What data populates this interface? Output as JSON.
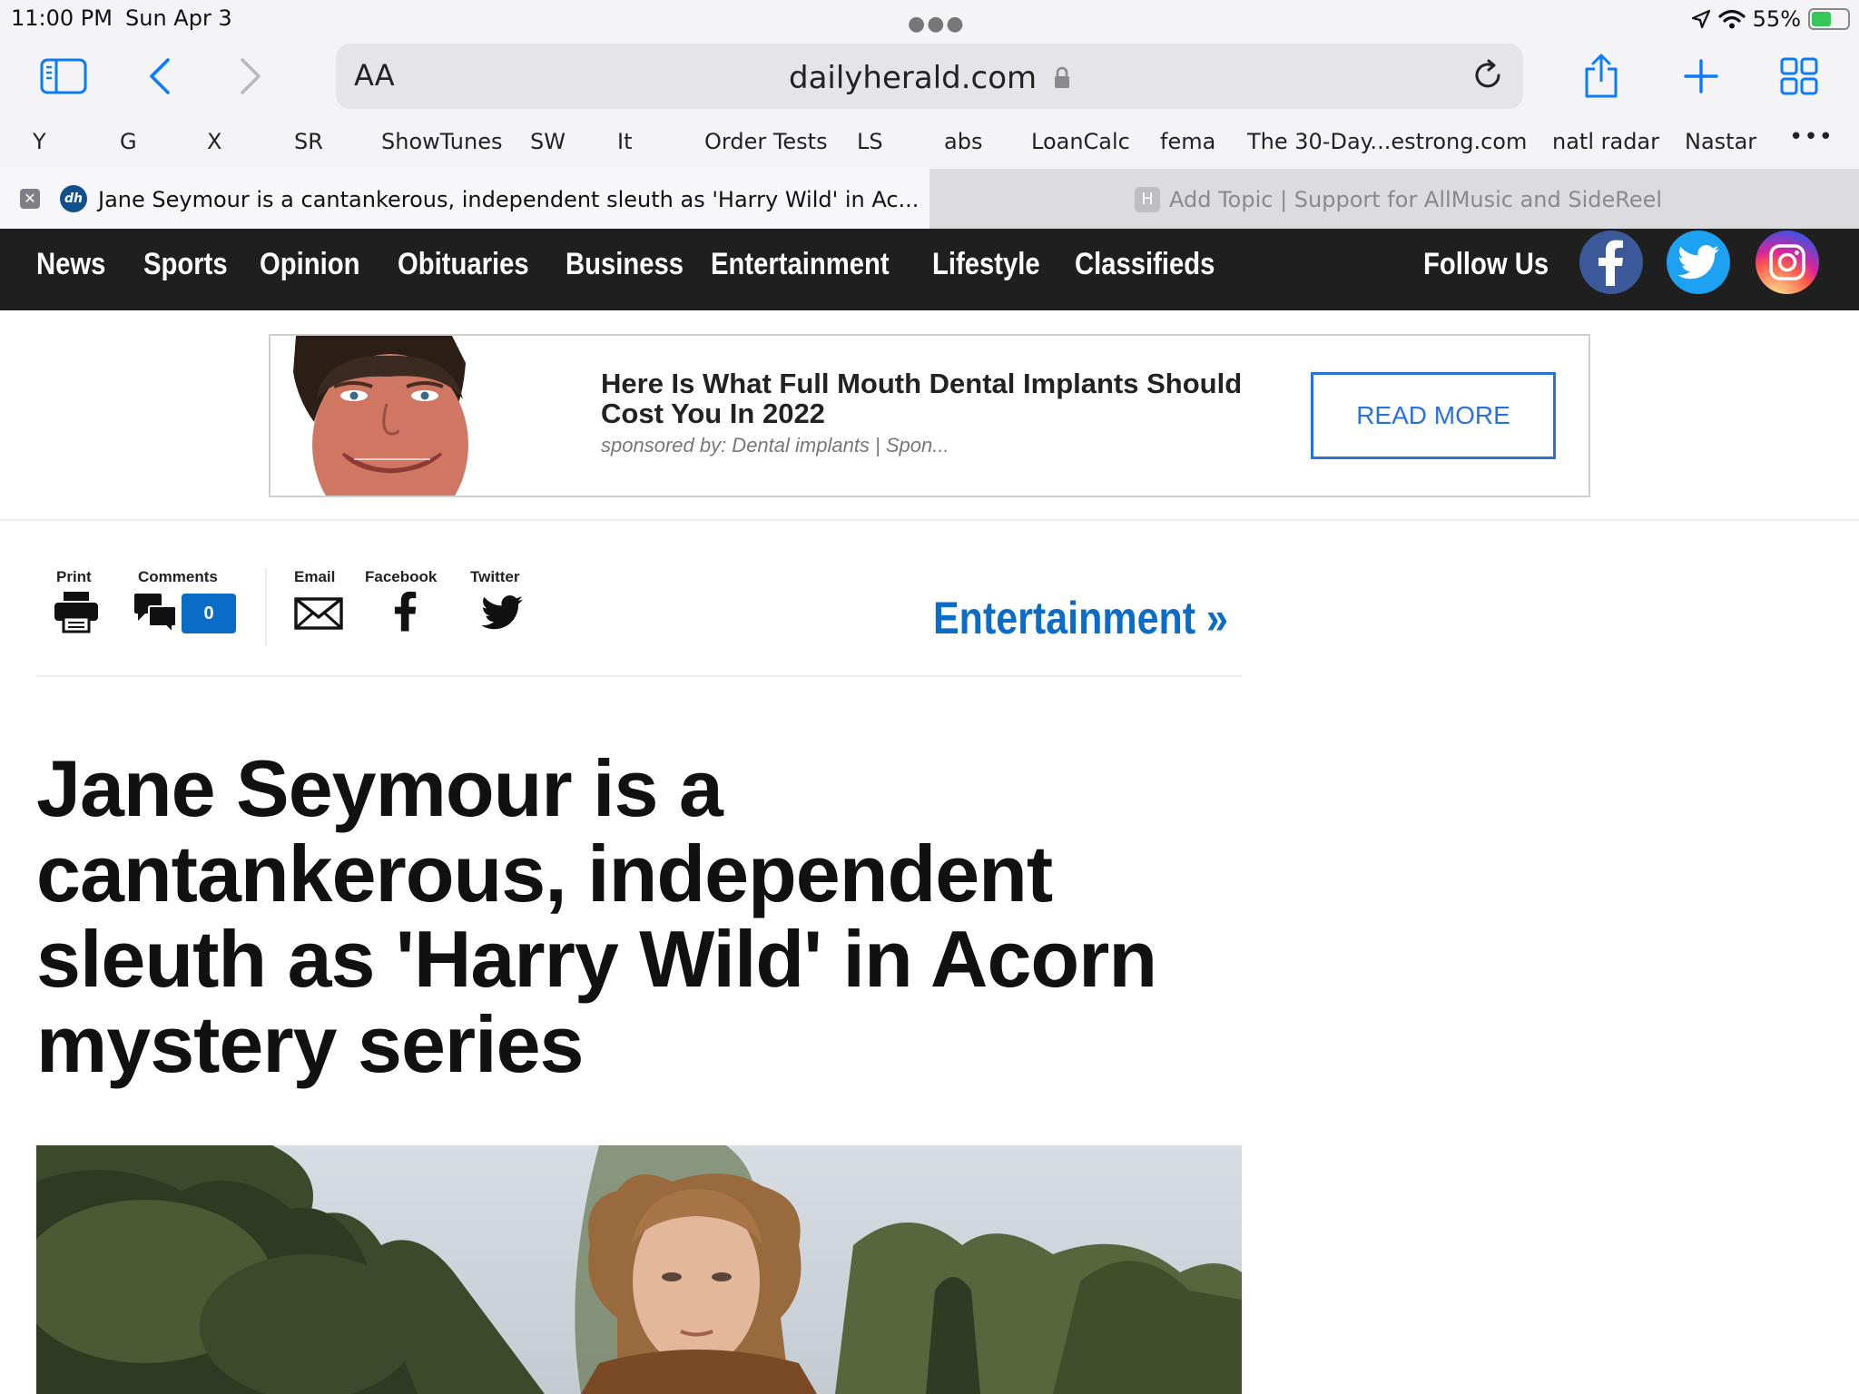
{
  "status": {
    "time": "11:00 PM",
    "date": "Sun Apr 3",
    "battery": "55%",
    "battery_level": 0.55
  },
  "browser": {
    "aa": "AA",
    "url": "dailyherald.com",
    "favorites": [
      "Y",
      "G",
      "X",
      "SR",
      "ShowTunes",
      "SW",
      "It",
      "Order Tests",
      "LS",
      "abs",
      "LoanCalc",
      "fema",
      "The 30-Day...estrong.com",
      "natl radar",
      "Nastar"
    ],
    "tabs": [
      {
        "favicon": "dh",
        "title": "Jane Seymour is a cantankerous, independent sleuth as 'Harry Wild' in Ac..."
      },
      {
        "favicon": "H",
        "title": "Add Topic | Support for AllMusic and SideReel"
      }
    ]
  },
  "site_nav": {
    "items": [
      "News",
      "Sports",
      "Opinion",
      "Obituaries",
      "Business",
      "Entertainment",
      "Lifestyle",
      "Classifieds"
    ],
    "follow_label": "Follow Us"
  },
  "ad": {
    "headline": "Here Is What Full Mouth Dental Implants Should Cost You In 2022",
    "sponsor": "sponsored by: Dental implants | Spon...",
    "cta": "READ MORE"
  },
  "share": {
    "print": "Print",
    "comments": "Comments",
    "comment_count": "0",
    "email": "Email",
    "facebook": "Facebook",
    "twitter": "Twitter"
  },
  "article": {
    "section": "Entertainment »",
    "headline": "Jane Seymour is a cantankerous, independent sleuth as 'Harry Wild' in Acorn mystery series"
  },
  "colors": {
    "nav_bg": "#1f1f1f",
    "link_blue": "#0a6cc4",
    "ios_blue": "#0a7aff",
    "facebook": "#3b5998",
    "twitter": "#1da1f2"
  }
}
